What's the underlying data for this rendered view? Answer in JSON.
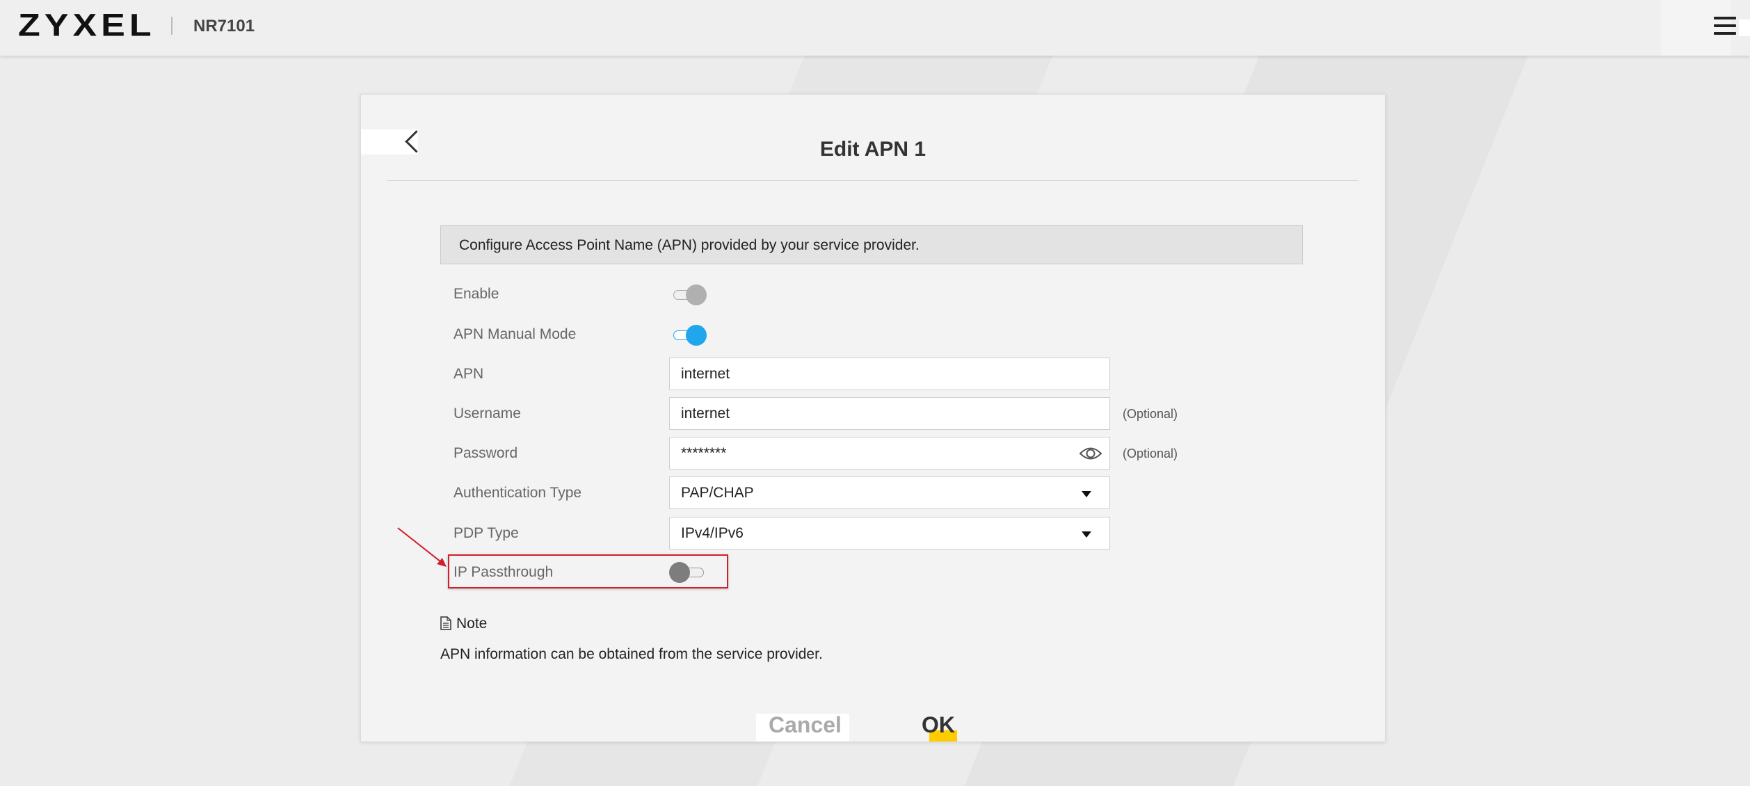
{
  "header": {
    "brand": "ZYXEL",
    "model": "NR7101"
  },
  "dialog": {
    "title": "Edit APN 1",
    "info": "Configure Access Point Name (APN) provided by your service provider.",
    "fields": {
      "enable": {
        "label": "Enable",
        "state": "off-disabled"
      },
      "apn_manual_mode": {
        "label": "APN Manual Mode",
        "state": "on"
      },
      "apn": {
        "label": "APN",
        "value": "internet"
      },
      "username": {
        "label": "Username",
        "value": "internet",
        "hint": "(Optional)"
      },
      "password": {
        "label": "Password",
        "value": "********",
        "hint": "(Optional)"
      },
      "auth_type": {
        "label": "Authentication Type",
        "value": "PAP/CHAP"
      },
      "pdp_type": {
        "label": "PDP Type",
        "value": "IPv4/IPv6"
      },
      "ip_passthrough": {
        "label": "IP Passthrough",
        "state": "off"
      }
    },
    "note": {
      "label": "Note",
      "text": "APN information can be obtained from the service provider."
    },
    "buttons": {
      "cancel": "Cancel",
      "ok": "OK"
    }
  },
  "colors": {
    "toggle_on": "#20a6ec",
    "highlight": "#d0202c",
    "ok_accent": "#ffcc00"
  },
  "icons": [
    "hamburger-menu-icon",
    "chevron-left-icon",
    "eye-icon",
    "chevron-down-icon",
    "document-icon",
    "arrow-annotation"
  ]
}
